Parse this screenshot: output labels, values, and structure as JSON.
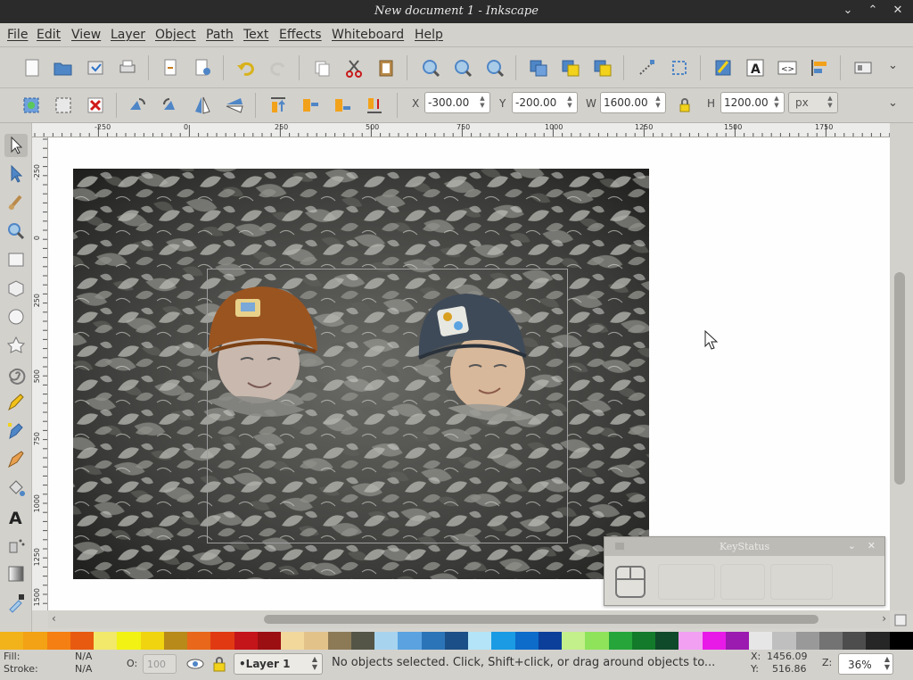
{
  "window": {
    "title": "New document 1 - Inkscape"
  },
  "menu": [
    "File",
    "Edit",
    "View",
    "Layer",
    "Object",
    "Path",
    "Text",
    "Effects",
    "Whiteboard",
    "Help"
  ],
  "controls": {
    "x_label": "X",
    "x_value": "-300.00",
    "y_label": "Y",
    "y_value": "-200.00",
    "w_label": "W",
    "w_value": "1600.00",
    "h_label": "H",
    "h_value": "1200.00",
    "unit": "px"
  },
  "ruler": {
    "h_ticks": [
      "-250",
      "0",
      "250",
      "500",
      "750",
      "1000",
      "1250",
      "1500",
      "1750"
    ],
    "v_ticks": [
      "-250",
      "0",
      "250",
      "500",
      "750",
      "1000",
      "1250",
      "1500"
    ]
  },
  "keystatus": {
    "title": "KeyStatus"
  },
  "palette": [
    "#f2b21a",
    "#f2a214",
    "#f57f12",
    "#e85a10",
    "#f2e86a",
    "#f2f214",
    "#efd40f",
    "#b88a1a",
    "#e8671a",
    "#e13a12",
    "#c3151a",
    "#9b0f12",
    "#f2d99b",
    "#e3c28a",
    "#8c7a57",
    "#555547",
    "#a7d3ef",
    "#5aa2e0",
    "#2c74b8",
    "#1b4f87",
    "#b3e4f7",
    "#1a9be3",
    "#0d6bc9",
    "#0b3f9a",
    "#c3f08a",
    "#8ee35a",
    "#26a63a",
    "#127a2a",
    "#0f4a2a",
    "#f2a0f2",
    "#e81ae8",
    "#9b1ab0",
    "#e6e6e6",
    "#bfbfbf",
    "#999999",
    "#737373",
    "#4d4d4d",
    "#262626",
    "#000000"
  ],
  "status": {
    "fill_label": "Fill:",
    "fill_value": "N/A",
    "stroke_label": "Stroke:",
    "stroke_value": "N/A",
    "opacity_label": "O:",
    "opacity_value": "100",
    "layer": "•Layer 1",
    "message": "No objects selected. Click, Shift+click, or drag around objects to...",
    "coord_x_label": "X:",
    "coord_x": "1456.09",
    "coord_y_label": "Y:",
    "coord_y": "516.86",
    "zoom_label": "Z:",
    "zoom": "36%"
  }
}
